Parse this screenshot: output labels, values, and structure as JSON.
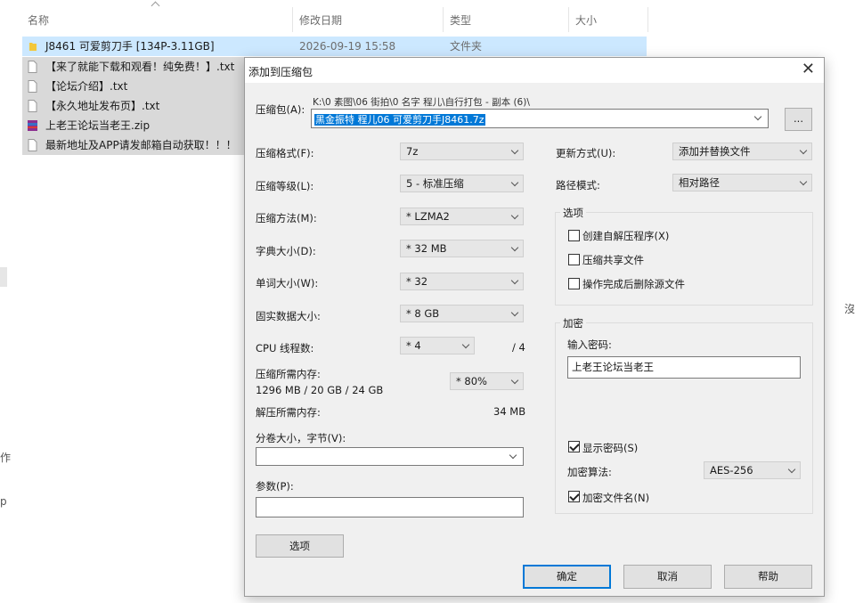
{
  "explorer": {
    "columns": {
      "name": "名称",
      "date": "修改日期",
      "type": "类型",
      "size": "大小"
    },
    "files": [
      {
        "name": "J8461 可爱剪刀手 [134P-3.11GB]",
        "date": "2026-09-19 15:58",
        "type": "文件夹",
        "icon": "folder-icon"
      },
      {
        "name": "【来了就能下载和观看！纯免费！】.txt",
        "date": "",
        "type": "",
        "icon": "text-file-icon"
      },
      {
        "name": "【论坛介绍】.txt",
        "date": "",
        "type": "",
        "icon": "text-file-icon"
      },
      {
        "name": "【永久地址发布页】.txt",
        "date": "",
        "type": "",
        "icon": "text-file-icon"
      },
      {
        "name": "上老王论坛当老王.zip",
        "date": "",
        "type": "",
        "icon": "zip-archive-icon"
      },
      {
        "name": "最新地址及APP请发邮箱自动获取！！！",
        "date": "",
        "type": "",
        "icon": "text-file-icon"
      }
    ],
    "edge_chars": [
      "沒",
      "作",
      "p"
    ]
  },
  "dialog": {
    "title": "添加到压缩包",
    "archive_label": "压缩包(A):",
    "archive_path_hint": "K:\\0 素图\\06 街拍\\0 名字 程儿\\自行打包 - 副本 (6)\\",
    "archive_name": "黑金振特 程儿06 可爱剪刀手J8461.7z",
    "browse_label": "...",
    "left": [
      {
        "label": "压缩格式(F):",
        "value": "7z"
      },
      {
        "label": "压缩等级(L):",
        "value": "5 - 标准压缩"
      },
      {
        "label": "压缩方法(M):",
        "value": "* LZMA2"
      },
      {
        "label": "字典大小(D):",
        "value": "* 32 MB"
      },
      {
        "label": "单词大小(W):",
        "value": "* 32"
      },
      {
        "label": "固实数据大小:",
        "value": "* 8 GB"
      }
    ],
    "cpu": {
      "label": "CPU 线程数:",
      "value": "* 4",
      "max": "/ 4"
    },
    "mem_compress": {
      "label": "压缩所需内存:",
      "detail": "1296 MB / 20 GB / 24 GB",
      "value": "* 80%"
    },
    "mem_decompress": {
      "label": "解压所需内存:",
      "value": "34 MB"
    },
    "split": {
      "label": "分卷大小，字节(V):",
      "value": ""
    },
    "params": {
      "label": "参数(P):",
      "value": ""
    },
    "options_button": "选项",
    "update_mode": {
      "label": "更新方式(U):",
      "value": "添加并替换文件"
    },
    "path_mode": {
      "label": "路径模式:",
      "value": "相对路径"
    },
    "options_group": {
      "title": "选项",
      "items": [
        {
          "label": "创建自解压程序(X)",
          "checked": false
        },
        {
          "label": "压缩共享文件",
          "checked": false
        },
        {
          "label": "操作完成后删除源文件",
          "checked": false
        }
      ]
    },
    "encryption": {
      "title": "加密",
      "password_label": "输入密码:",
      "password_value": "上老王论坛当老王",
      "show_password": {
        "label": "显示密码(S)",
        "checked": true
      },
      "method_label": "加密算法:",
      "method_value": "AES-256",
      "encrypt_names": {
        "label": "加密文件名(N)",
        "checked": true
      }
    },
    "buttons": {
      "ok": "确定",
      "cancel": "取消",
      "help": "帮助"
    }
  },
  "colors": {
    "selection": "#cce8ff",
    "accent": "#0078d7",
    "dialog_bg": "#f0f0f0"
  }
}
